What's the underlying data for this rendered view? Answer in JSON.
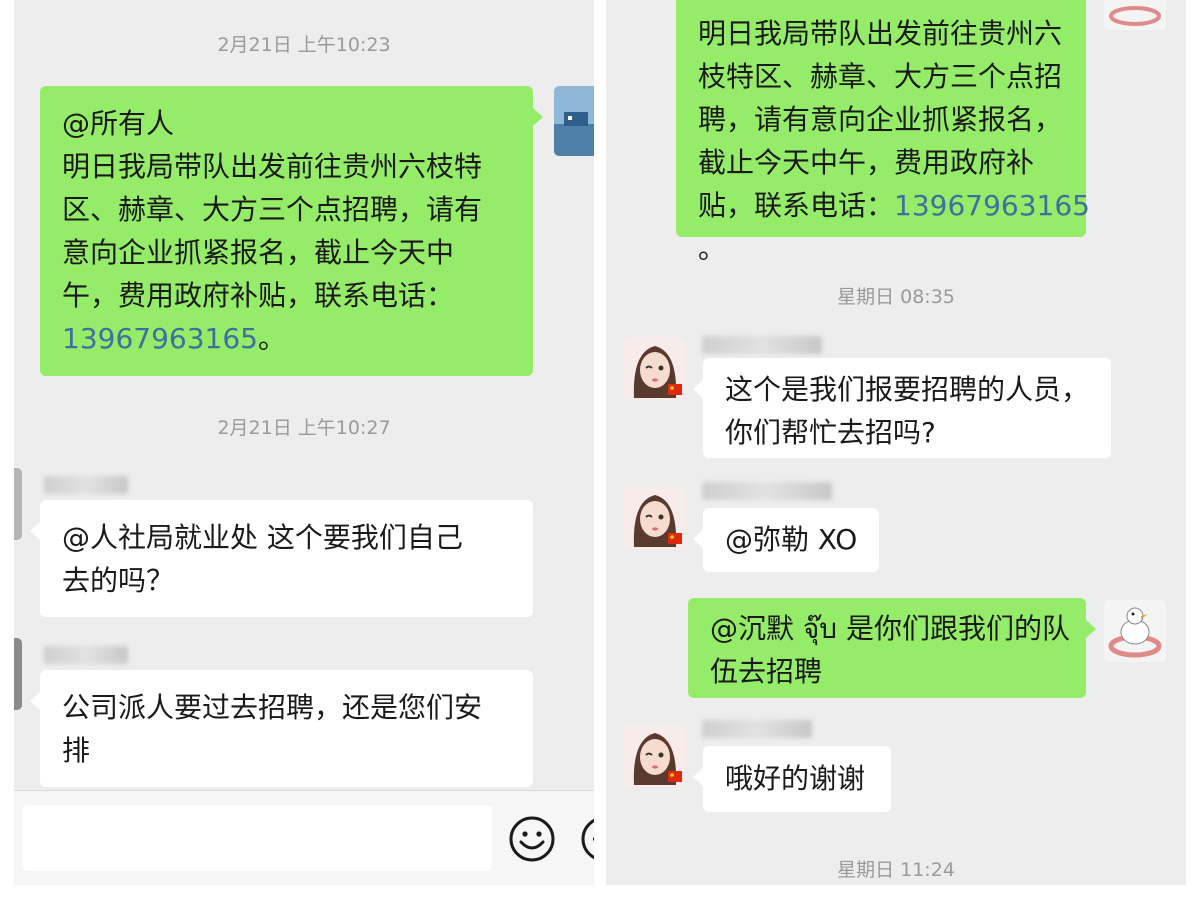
{
  "left": {
    "timestamps": [
      "2月21日 上午10:23",
      "2月21日 上午10:27"
    ],
    "messages": [
      {
        "side": "right",
        "lines": [
          "@所有人",
          "明日我局带队出发前往贵州六枝特",
          "区、赫章、大方三个点招聘，请有",
          "意向企业抓紧报名，截止今天中",
          "午，费用政府补贴，联系电话："
        ],
        "phone": "13967963165",
        "phone_suffix": "。"
      },
      {
        "side": "left",
        "lines": [
          "@人社局就业处  这个要我们自己",
          "去的吗？"
        ]
      },
      {
        "side": "left",
        "lines": [
          "公司派人要过去招聘，还是您们安",
          "排"
        ]
      }
    ],
    "input": {
      "placeholder": ""
    },
    "icons": {
      "emoji": "emoji-icon",
      "plus": "plus-icon"
    }
  },
  "right": {
    "timestamps": [
      "星期日 08:35",
      "星期日 11:24"
    ],
    "messages": [
      {
        "side": "right",
        "lines": [
          "明日我局带队出发前往贵州六",
          "枝特区、赫章、大方三个点招",
          "聘，请有意向企业抓紧报名，",
          "截止今天中午，费用政府补",
          "贴，联系电话："
        ],
        "phone": "13967963165",
        "tail_line": "。"
      },
      {
        "side": "left",
        "lines": [
          "这个是我们报要招聘的人员，",
          "你们帮忙去招吗?"
        ]
      },
      {
        "side": "left",
        "lines": [
          "@弥勒 XO"
        ]
      },
      {
        "side": "right",
        "lines": [
          "@沉默 จุ๊บ 是你们跟我们的队",
          "伍去招聘"
        ]
      },
      {
        "side": "left",
        "lines": [
          "哦好的谢谢"
        ]
      }
    ]
  },
  "colors": {
    "sent_bubble": "#95ec69",
    "received_bubble": "#ffffff",
    "background": "#ededed",
    "phone_link": "#3f6f9e",
    "timestamp": "#9a9a9a"
  }
}
